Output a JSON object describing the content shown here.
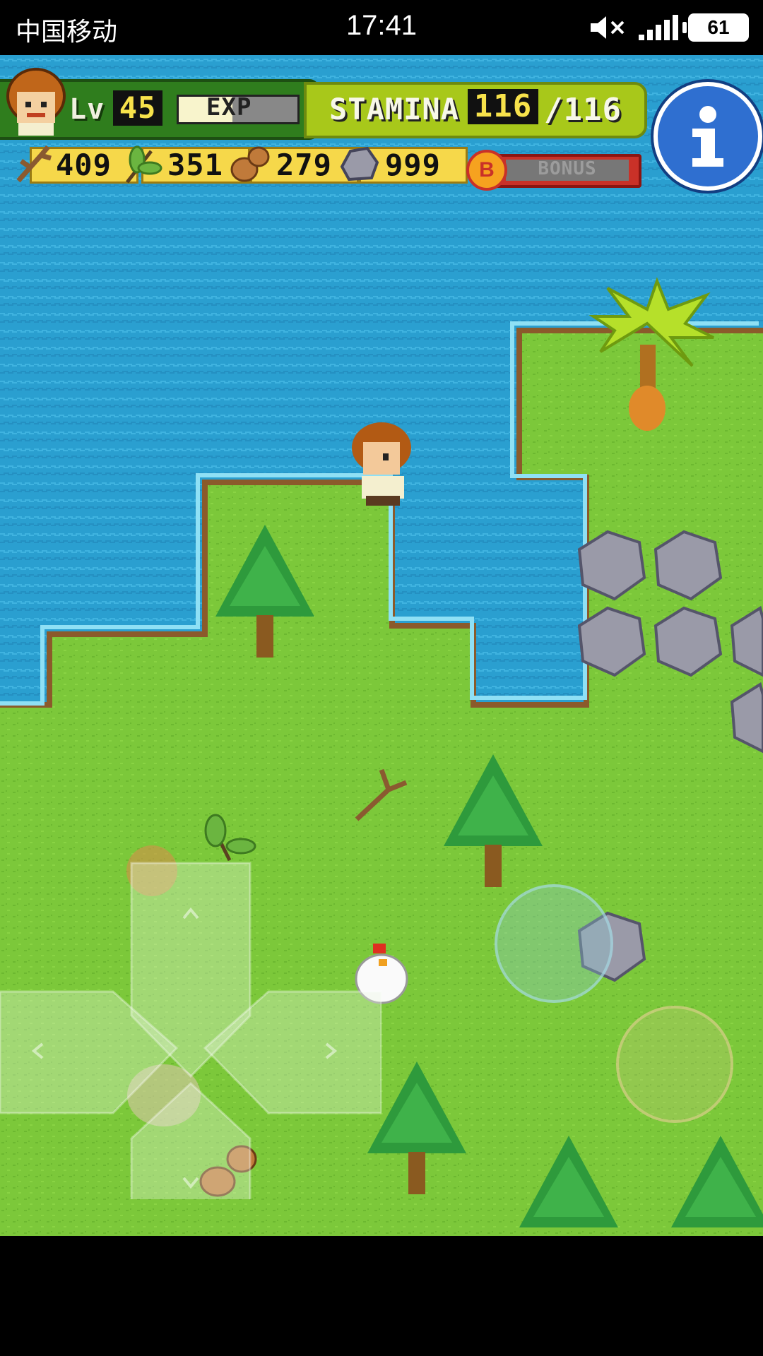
{
  "status_bar": {
    "carrier": "中国移动",
    "time": "17:41",
    "battery": "61",
    "icons": [
      "mute-icon",
      "signal-icon",
      "battery-icon"
    ]
  },
  "hud": {
    "level_label": "Lv",
    "level": "45",
    "exp_label": "EXP",
    "exp_fraction": 0.45,
    "stamina_label": "STAMINA",
    "stamina_current": "116",
    "stamina_max": "/116",
    "bonus_label": "BONUS",
    "bonus_icon_letter": "B",
    "resources": [
      {
        "name": "branches",
        "icon": "branch-icon",
        "value": "409"
      },
      {
        "name": "leaves",
        "icon": "leaf-icon",
        "value": "351"
      },
      {
        "name": "nuts",
        "icon": "nut-icon",
        "value": "279"
      },
      {
        "name": "stones",
        "icon": "stone-icon",
        "value": "999"
      }
    ],
    "info_icon": "info-icon"
  },
  "colors": {
    "water": "#2a9fd0",
    "grass": "#7cc83a",
    "hud_green": "#2f7d1d",
    "stamina_green": "#a8c81a",
    "resource_yellow": "#f6d84a",
    "info_blue": "#2f6fd0",
    "bonus_red": "#c93128"
  }
}
